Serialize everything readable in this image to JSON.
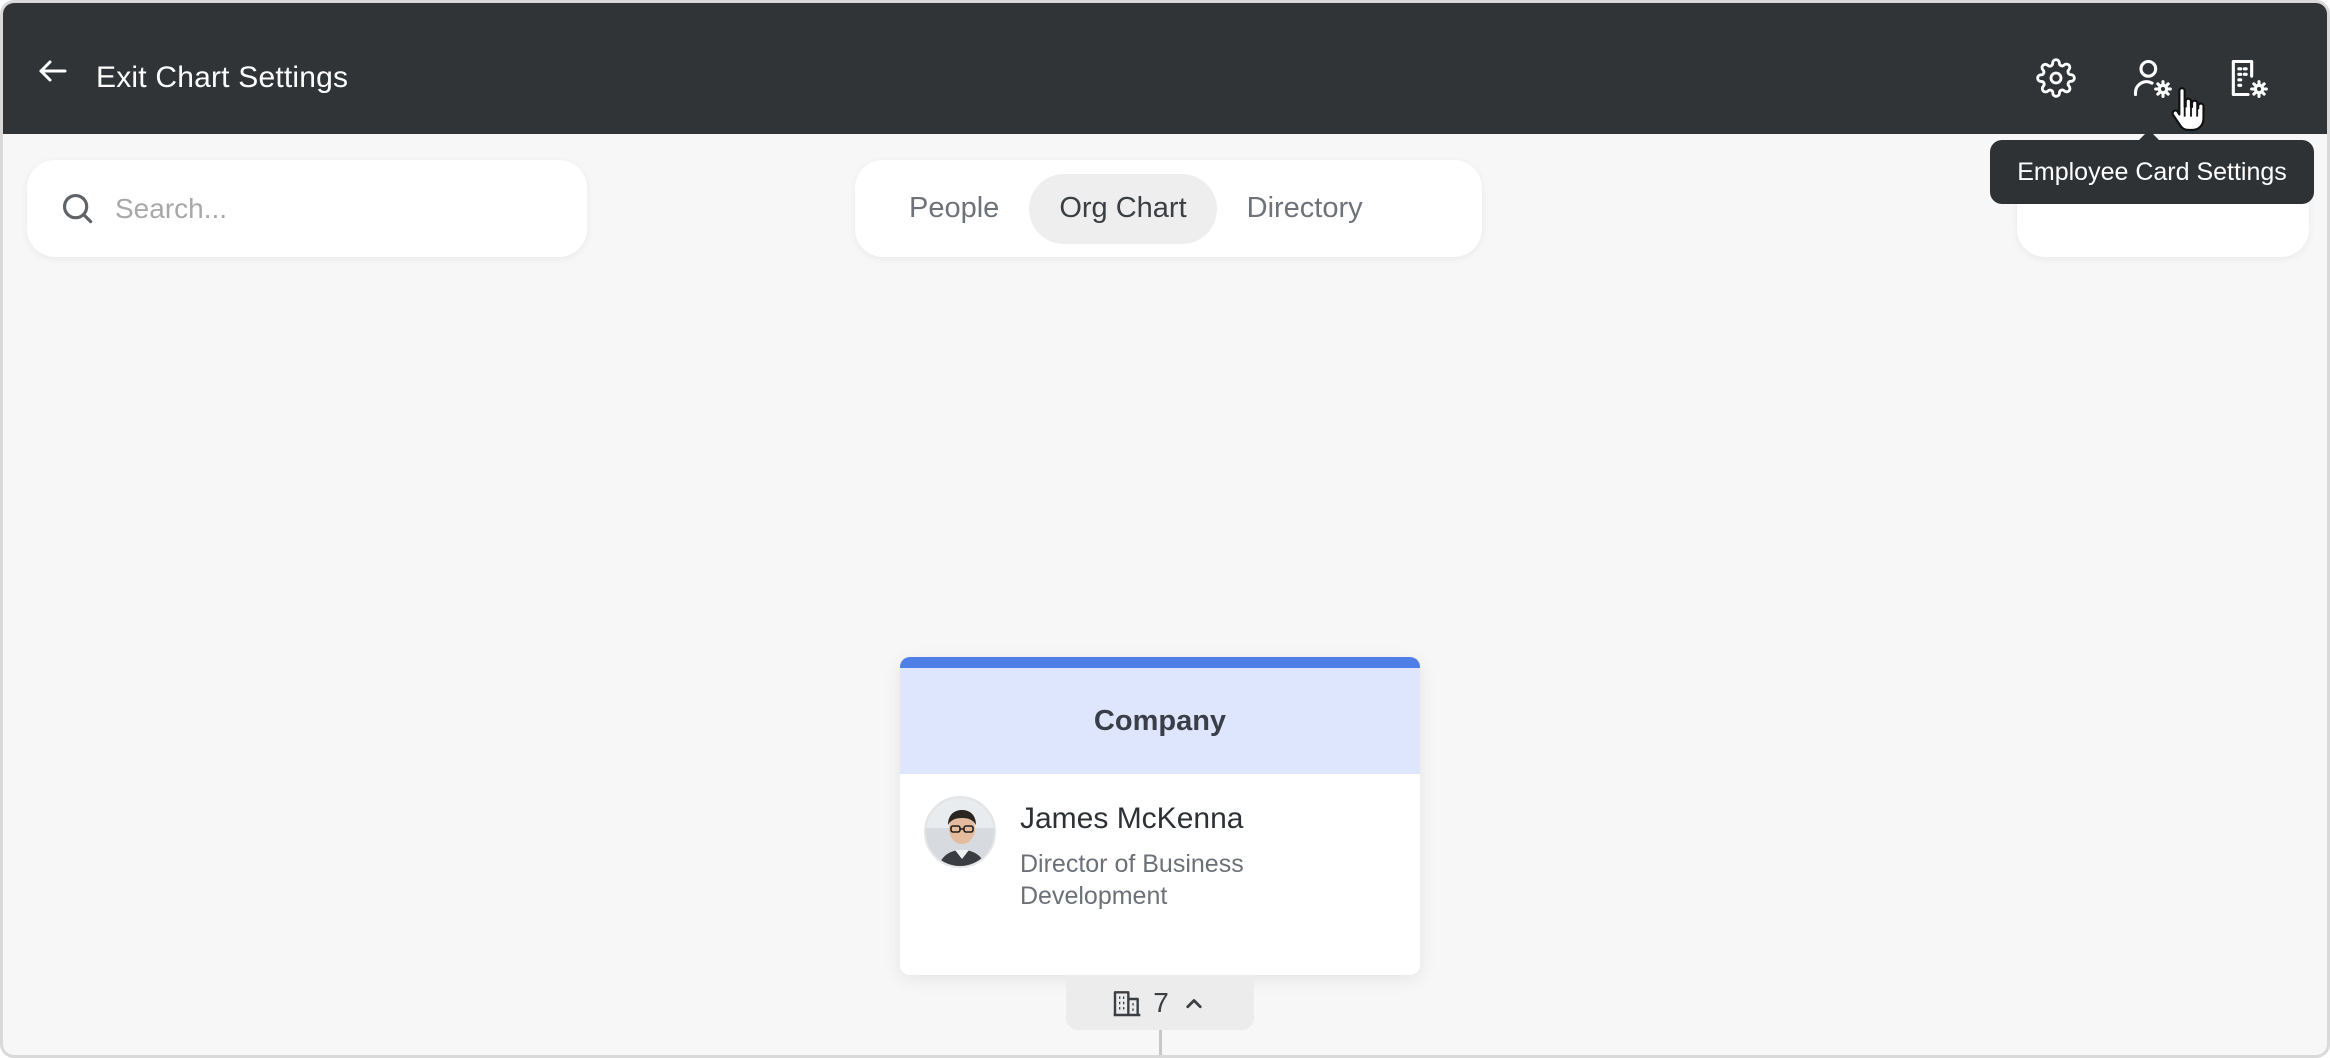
{
  "header": {
    "exit_label": "Exit Chart Settings",
    "icons": {
      "back": "arrow-left-icon",
      "settings": "gear-icon",
      "card": "user-gear-icon",
      "org": "building-gear-icon"
    }
  },
  "tooltip": {
    "text": "Employee Card Settings"
  },
  "search": {
    "placeholder": "Search...",
    "value": ""
  },
  "view_tabs": [
    {
      "label": "People",
      "active": false
    },
    {
      "label": "Org Chart",
      "active": true
    },
    {
      "label": "Directory",
      "active": false
    }
  ],
  "org_card": {
    "department": "Company",
    "person_name": "James McKenna",
    "person_title": "Director of Business Development",
    "reports_count": "7"
  },
  "colors": {
    "topbar": "#313437",
    "accent": "#4f7fe6",
    "department_bg": "#dde6fd",
    "canvas": "#f7f7f7"
  }
}
